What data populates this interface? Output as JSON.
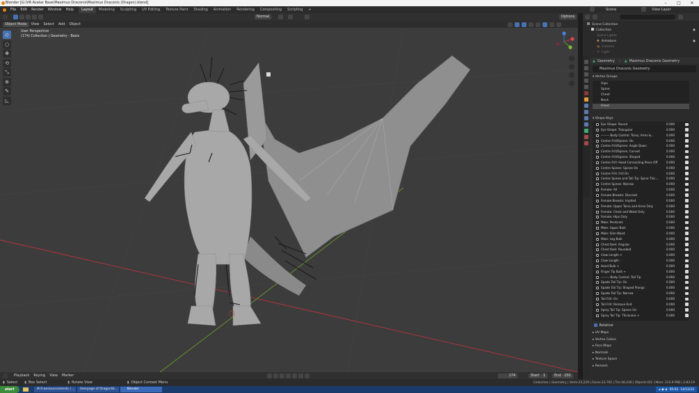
{
  "window": {
    "title": "Blender [G:\\VR Avatar Base\\Maximus Draconis\\Maximus Draconis (Dragon).blend]",
    "min": "–",
    "max": "□",
    "close": "✕"
  },
  "menu": [
    "File",
    "Edit",
    "Render",
    "Window",
    "Help"
  ],
  "workspaces": [
    "Layout",
    "Modeling",
    "Sculpting",
    "UV Editing",
    "Texture Paint",
    "Shading",
    "Animation",
    "Rendering",
    "Compositing",
    "Scripting"
  ],
  "workspace_add": "+",
  "topright": {
    "scene_label": "Scene",
    "view_layer_label": "View Layer"
  },
  "viewport_header": {
    "mode": "Object Mode",
    "view": "View",
    "select": "Select",
    "add": "Add",
    "object": "Object",
    "orientation": "Normal",
    "options": "Options"
  },
  "viewport_info": {
    "line1": "User Perspective",
    "line2": "(174) Collection | Geometry - Basis"
  },
  "tools": [
    "◇",
    "○",
    "✥",
    "⟲",
    "⤡",
    "⊕",
    "✎",
    "◺"
  ],
  "outliner": {
    "search_placeholder": "",
    "rows": [
      {
        "label": "Scene Collection",
        "indent": 0,
        "dim": false
      },
      {
        "label": "Collection",
        "indent": 1,
        "dim": false
      },
      {
        "label": "Scene Lights",
        "indent": 2,
        "dim": true
      },
      {
        "label": "Armature",
        "indent": 2,
        "dim": false
      },
      {
        "label": "Camera",
        "indent": 2,
        "dim": true
      },
      {
        "label": "Light",
        "indent": 2,
        "dim": true
      }
    ]
  },
  "properties": {
    "breadcrumb_object": "Geometry",
    "breadcrumb_data": "Maximus Draconis Geometry",
    "data_name": "Maximus Draconis Geometry",
    "vertex_groups_title": "Vertex Groups",
    "vertex_groups": [
      "Hips",
      "Spine",
      "Chest",
      "Neck",
      "Head"
    ],
    "shape_keys_title": "Shape Keys",
    "shape_keys": [
      {
        "name": "Eye Shape: Round",
        "value": "0.000"
      },
      {
        "name": "Eye Shape: Triangular",
        "value": "0.000"
      },
      {
        "name": "-------- Body Control: Torso, Arms &...",
        "value": "0.000"
      },
      {
        "name": "Centre Frill/Spines: On",
        "value": "0.000"
      },
      {
        "name": "Centre Frill/Spines: Angle Down",
        "value": "0.000"
      },
      {
        "name": "Centre Frill/Spines: Curved",
        "value": "0.000"
      },
      {
        "name": "Centre Frill/Spines: Shaped",
        "value": "0.000"
      },
      {
        "name": "Centre Frill: Head Connecting Piece Off",
        "value": "0.000"
      },
      {
        "name": "Centre Spines: Spines On",
        "value": "0.000"
      },
      {
        "name": "Centre Frill: Frill On",
        "value": "0.000"
      },
      {
        "name": "Centre Spines and Tail Tip: Spine Thic...",
        "value": "0.000"
      },
      {
        "name": "Centre Spines: Narrow",
        "value": "0.000"
      },
      {
        "name": "Female: All",
        "value": "0.000"
      },
      {
        "name": "Female Breasts: Discreet",
        "value": "0.000"
      },
      {
        "name": "Female Breasts: Implied",
        "value": "0.000"
      },
      {
        "name": "Female: Upper Torso and Arms Only",
        "value": "0.000"
      },
      {
        "name": "Female: Chest and Waist Only",
        "value": "0.000"
      },
      {
        "name": "Female: Hips Only",
        "value": "0.000"
      },
      {
        "name": "Male: Pectorals",
        "value": "0.000"
      },
      {
        "name": "Male: Upper Bulk",
        "value": "0.000"
      },
      {
        "name": "Male: Slim Waist",
        "value": "0.000"
      },
      {
        "name": "Male: Leg Bulk",
        "value": "0.000"
      },
      {
        "name": "Chest Keel: Angular",
        "value": "0.000"
      },
      {
        "name": "Chest Keel: Rounded",
        "value": "0.000"
      },
      {
        "name": "Claw Length +",
        "value": "0.000"
      },
      {
        "name": "Claw Length -",
        "value": "0.000"
      },
      {
        "name": "Hand Bulk +",
        "value": "0.000"
      },
      {
        "name": "Finger Tip Bulk +",
        "value": "0.000"
      },
      {
        "name": "-------- Body Control: Tail Tip",
        "value": "0.000"
      },
      {
        "name": "Spade Tail Tip: On",
        "value": "0.000"
      },
      {
        "name": "Spade Tail Tip: Shaped Prongs",
        "value": "0.000"
      },
      {
        "name": "Spade Tail Tip: Narrow",
        "value": "0.000"
      },
      {
        "name": "Tail Frill: On",
        "value": "0.000"
      },
      {
        "name": "Tail Frill: Remove End",
        "value": "0.000"
      },
      {
        "name": "Spiny Tail Tip: Spines On",
        "value": "0.000"
      },
      {
        "name": "Spiny Tail Tip: Thickness +",
        "value": "0.000"
      }
    ],
    "relative_label": "Relative",
    "panels": [
      "UV Maps",
      "Vertex Colors",
      "Face Maps",
      "Normals",
      "Texture Space",
      "Remesh"
    ]
  },
  "timeline": {
    "playback": "Playback",
    "keying": "Keying",
    "view": "View",
    "marker": "Marker",
    "current_frame": "174",
    "start_label": "Start",
    "start": "1",
    "end_label": "End",
    "end": "250"
  },
  "status": {
    "select": "Select",
    "box_select": "Box Select",
    "rotate_view": "Rotate View",
    "context_menu": "Object Context Menu",
    "stats": "Collection | Geometry | Verts:23,229 | Faces:23,762 | Tris:46,430 | Objects:0/2 | Mem: 212.9 MiB | 2.83.19"
  },
  "taskbar": {
    "start": "start",
    "items": [
      "#r3-announcements | ...",
      "Userpage of DragonSt...",
      "Blender"
    ],
    "time": "05:01",
    "date": "14/12/22"
  },
  "colors": {
    "viewport_bg": "#3c3c3c",
    "accent": "#4772b3",
    "x_axis": "#b8343e",
    "y_axis": "#6a9c2b"
  }
}
